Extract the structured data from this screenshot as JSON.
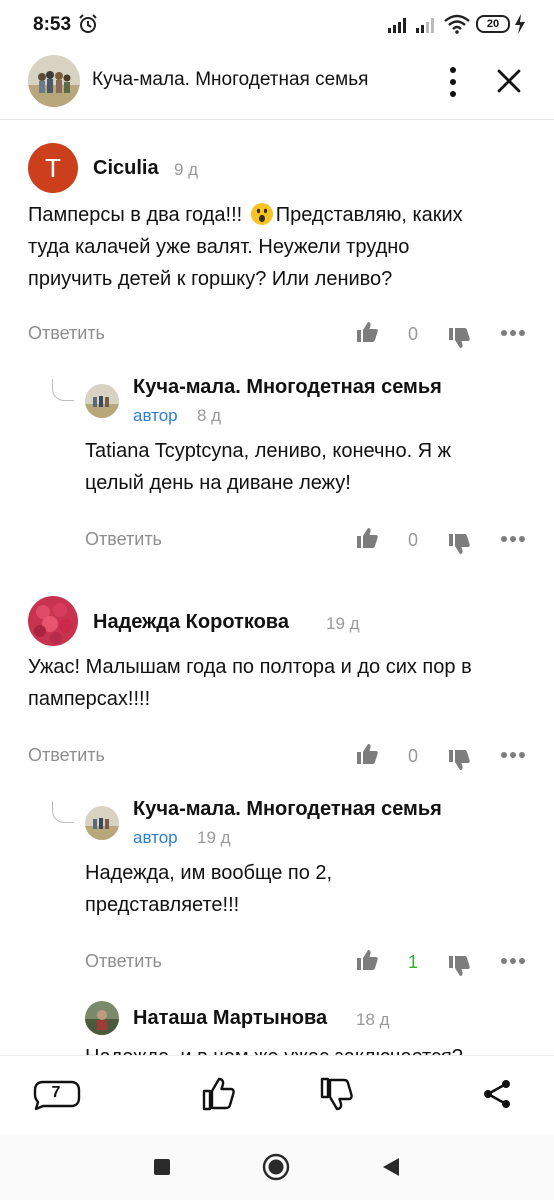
{
  "status_bar": {
    "time": "8:53",
    "battery": "20",
    "icons": [
      "alarm-icon",
      "signal-icon",
      "signal-icon",
      "wifi-icon",
      "battery-icon",
      "charging-bolt-icon"
    ]
  },
  "header": {
    "title": "Куча-мала. Многодетная семья",
    "icons": [
      "channel-avatar",
      "kebab-menu-icon",
      "close-icon"
    ]
  },
  "comments": [
    {
      "author": "Ciculia",
      "avatar_letter": "T",
      "avatar_color": "#cb3f1c",
      "time": "9 д",
      "text_lines": [
        "Памперсы в два года!!! ",
        "Представляю, каких",
        "туда калачей уже валят. Неужели трудно",
        "приучить детей к горшку? Или лениво?"
      ],
      "emoji": "astonished-face-emoji",
      "reply_label": "Ответить",
      "likes": "0"
    },
    {
      "author": "Куча-мала. Многодетная семья",
      "badge": "автор",
      "time": "8 д",
      "text_lines": [
        "Tatiana Tcyptcyna, лениво, конечно. Я ж",
        "целый день на диване лежу!"
      ],
      "reply_label": "Ответить",
      "likes": "0"
    },
    {
      "author": "Надежда Короткова",
      "time": "19 д",
      "text_lines": [
        "Ужас! Малышам года по полтора и до сих пор в",
        "памперсах!!!!"
      ],
      "reply_label": "Ответить",
      "likes": "0"
    },
    {
      "author": "Куча-мала. Многодетная семья",
      "badge": "автор",
      "time": "19 д",
      "text_lines": [
        "Надежда, им вообще по 2,",
        "представляете!!!"
      ],
      "reply_label": "Ответить",
      "likes": "1"
    },
    {
      "author": "Наташа Мартынова",
      "time": "18 д",
      "text_lines": [
        "Надежда, и в чем же ужас заключается?"
      ]
    }
  ],
  "bottom_bar": {
    "comments_count": "7",
    "icons": [
      "comments-icon",
      "like-icon",
      "dislike-icon",
      "share-icon"
    ]
  },
  "nav_bar": {
    "icons": [
      "recent-apps-icon",
      "home-icon",
      "back-icon"
    ]
  },
  "colors": {
    "accent_blue": "#2b7fd4",
    "like_green": "#2db52d",
    "muted_gray": "#9a9a9a"
  }
}
